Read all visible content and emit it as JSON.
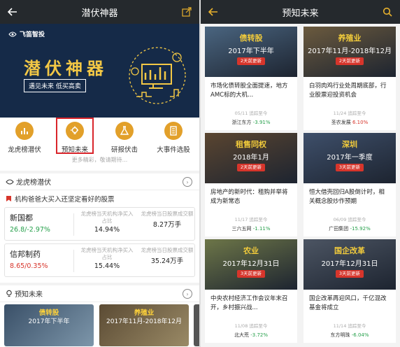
{
  "left": {
    "title": "潜伏神器",
    "banner": {
      "brand": "飞笛智投",
      "heading": "潜伏神器",
      "slogan": "遇见未来  低买高卖"
    },
    "tools": [
      {
        "label": "龙虎榜潜伏",
        "icon": "bar-chart-icon"
      },
      {
        "label": "预知未来",
        "icon": "lightbulb-icon"
      },
      {
        "label": "研报伏击",
        "icon": "flask-icon"
      },
      {
        "label": "大事件选股",
        "icon": "document-icon"
      }
    ],
    "more_hint": "更多精彩，敬请期待...",
    "dragon": {
      "title": "龙虎榜潜伏",
      "subtitle": "机构爸爸大买入还坚定看好的股票",
      "stocks": [
        {
          "name": "新国都",
          "price": "26.8/-2.97%",
          "color": "#26a04b",
          "col1_title": "龙虎榜当天机构净买入占比",
          "col1_value": "14.94%",
          "col2_title": "龙虎榜当日股票成交额",
          "col2_value": "8.27万手"
        },
        {
          "name": "信邦制药",
          "price": "8.65/0.35%",
          "color": "#d7352b",
          "col1_title": "龙虎榜当天机构净买入占比",
          "col1_value": "15.44%",
          "col2_title": "龙虎榜当日股票成交额",
          "col2_value": "35.24万手"
        }
      ]
    },
    "forecast": {
      "title": "预知未来",
      "thumbs": [
        {
          "cat": "债转股",
          "date": "2017年下半年"
        },
        {
          "cat": "养殖业",
          "date": "2017年11月-2018年12月"
        }
      ]
    }
  },
  "right": {
    "title": "预知未来",
    "cards": [
      {
        "cat": "债转股",
        "date": "2017年下半年",
        "badge": "2天前更新",
        "desc": "市场化债转股全面提速，地方AMC标的大机...",
        "meta": "05/11  追踪至今",
        "stock": "浙江东方",
        "change": "-3.91%",
        "change_color": "#26a04b",
        "bg": "#4a6580"
      },
      {
        "cat": "养殖业",
        "date": "2017年11月-2018年12月",
        "badge": "2天前更新",
        "desc": "白羽肉鸡行业处周期底部，行业股票迎投资机会",
        "meta": "11/24  追踪至今",
        "stock": "圣农发展",
        "change": "6.10%",
        "change_color": "#d7352b",
        "bg": "#6b5a3e"
      },
      {
        "cat": "租售同权",
        "date": "2018年1月",
        "badge": "2天前更新",
        "desc": "房地产的新时代：租购并举将成为新常态",
        "meta": "11/17  追踪至今",
        "stock": "三六五网",
        "change": "-1.11%",
        "change_color": "#26a04b",
        "bg": "#5a4530"
      },
      {
        "cat": "深圳",
        "date": "2017年一季度",
        "badge": "3天前更新",
        "desc": "恒大借壳回归A股倒计时，相关概念股炒作预期",
        "meta": "06/09  追踪至今",
        "stock": "广田集团",
        "change": "-15.92%",
        "change_color": "#26a04b",
        "bg": "#3e4f6a"
      },
      {
        "cat": "农业",
        "date": "2017年12月31日",
        "badge": "3天前更新",
        "desc": "中央农村经济工作会议年末召开，乡村振兴战...",
        "meta": "11/08  追踪至今",
        "stock": "北大荒",
        "change": "-3.72%",
        "change_color": "#26a04b",
        "bg": "#6d7648"
      },
      {
        "cat": "国企改革",
        "date": "2017年12月31日",
        "badge": "3天前更新",
        "desc": "国企改革再迎风口，千亿混改基金将成立",
        "meta": "11/14  追踪至今",
        "stock": "东方明珠",
        "change": "-6.04%",
        "change_color": "#26a04b",
        "bg": "#4c5563"
      }
    ]
  }
}
